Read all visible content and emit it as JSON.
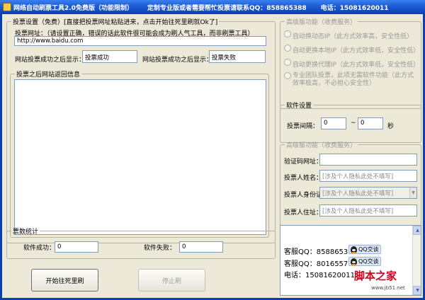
{
  "window": {
    "title": "网络自动刷票工具2.0免费版（功能限制）",
    "contact_notice": "定制专业版或者需要帮忙投票请联系QQ：858865388",
    "phone_notice": "电话：15081620011"
  },
  "vote_settings": {
    "legend": "投票设置（免费）[直接把投票网址粘贴进来，点击开始往死里刷就Ok了]",
    "url_label": "投票网址：（请设置正确，错误的话此软件很可能会成为刷人气工具，而非刷票工具）",
    "url_value": "http://www.baidu.com",
    "success_label": "网站投票成功之后显示：",
    "success_value": "投票成功",
    "fail_label": "网站投票成功之后显示：",
    "fail_value": "投票失败",
    "return_info_legend": "投票之后网站返回信息"
  },
  "advanced_service": {
    "legend": "高级版功能（收费服务）",
    "options": [
      "自动换动态IP（此方式效率高，安全性低）",
      "自动更换本地IP（此方式效率低，安全性低）",
      "自动更换代理IP（此方式效率低，安全性低）",
      "专业团队投票，此项无需软件功能（此方式效率极高，不必担心安全性）"
    ]
  },
  "software_settings": {
    "legend": "软件设置",
    "interval_label": "投票间隔：",
    "interval_from": "0",
    "interval_sep": "~",
    "interval_to": "0",
    "interval_unit": "秒"
  },
  "advanced_features": {
    "legend": "高级版功能（收费服务）",
    "captcha_label": "验证码网址：",
    "captcha_value": "",
    "name_label": "投票人姓名：",
    "name_placeholder": "[涉及个人隐私此处不填写]",
    "id_label": "投票人身份证：",
    "id_placeholder": "[涉及个人隐私此处不填写]",
    "address_label": "投票人住址：",
    "address_placeholder": "[涉及个人隐私此处不填写]"
  },
  "stats": {
    "legend": "票数统计",
    "success_label": "软件成功：",
    "success_value": "0",
    "fail_label": "软件失败：",
    "fail_value": "0"
  },
  "buttons": {
    "start": "开始往死里刷",
    "stop": "停止刷"
  },
  "contact_panel": {
    "line1": "客服QQ：858865388",
    "line2": "客服QQ：80165577",
    "line3": "电话：15081620011",
    "qq_button": "QQ交谈"
  },
  "watermark": {
    "text": "脚本之家",
    "url": "www.jb51.net"
  },
  "colors": {
    "titlebar": "#0a3fb8",
    "face": "#ece9d8",
    "input_border": "#7f9db9",
    "watermark": "#d1001c"
  }
}
